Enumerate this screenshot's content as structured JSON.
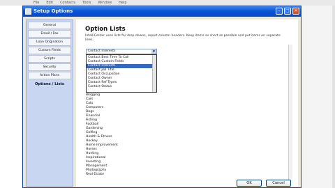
{
  "top_menu": [
    "File",
    "Edit",
    "Contacts",
    "Tools",
    "Window",
    "Help"
  ],
  "window": {
    "title": "Setup Options"
  },
  "sidebar": {
    "items": [
      {
        "label": "General"
      },
      {
        "label": "Email / Fax"
      },
      {
        "label": "Loan Origination"
      },
      {
        "label": "Custom Fields"
      },
      {
        "label": "Scripts"
      },
      {
        "label": "Security"
      },
      {
        "label": "Action Plans"
      },
      {
        "label": "Options / Lists"
      }
    ],
    "active_index": 7
  },
  "main": {
    "heading": "Option Lists",
    "description": "IntelliCenter uses lists for drop downs, report column headers. Keep items as short as possible and put items on separate lines.",
    "select": {
      "value": "Contact Interests"
    },
    "dropdown_options": [
      "Contact Interests",
      "Contact Best Time To Call",
      "Contact Custom Fields",
      "Contact Interests",
      "Contact Job Title",
      "Contact Occupation",
      "Contact Owner",
      "Contact Ref Types",
      "Contact Status"
    ],
    "dropdown_selected_index": 3,
    "list_items": [
      "Blogging",
      "Cars",
      "Cats",
      "Computers",
      "Dogs",
      "Financial",
      "Fishing",
      "Football",
      "Gardening",
      "Golfing",
      "Health & Fitness",
      "Hockey",
      "Home Improvement",
      "Horses",
      "Hunting",
      "Inspirational",
      "Investing",
      "Management",
      "Photography",
      "Real Estate"
    ]
  },
  "footer": {
    "ok_label": "OK",
    "cancel_label": "Cancel"
  }
}
